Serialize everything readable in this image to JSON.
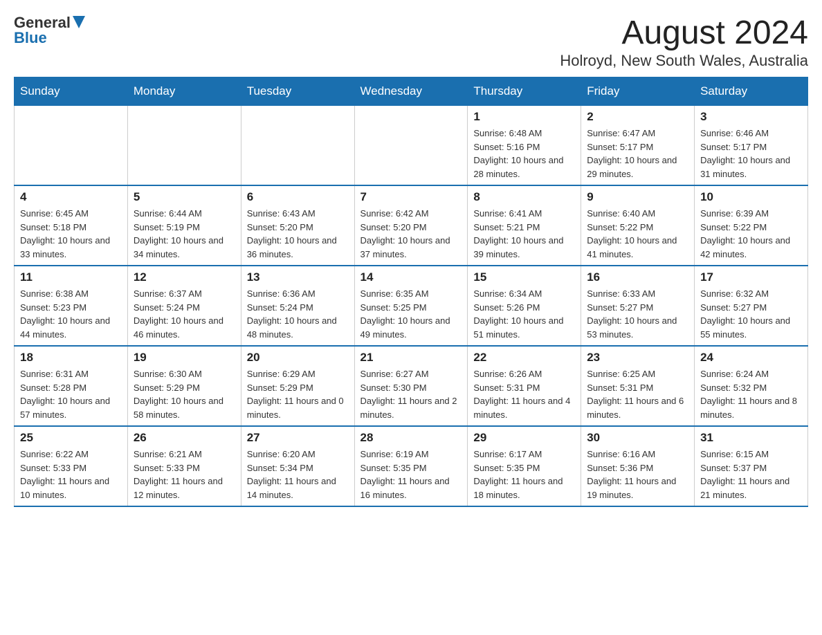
{
  "header": {
    "logo_general": "General",
    "logo_blue": "Blue",
    "month_title": "August 2024",
    "location": "Holroyd, New South Wales, Australia"
  },
  "weekdays": [
    "Sunday",
    "Monday",
    "Tuesday",
    "Wednesday",
    "Thursday",
    "Friday",
    "Saturday"
  ],
  "weeks": [
    [
      {
        "day": "",
        "info": ""
      },
      {
        "day": "",
        "info": ""
      },
      {
        "day": "",
        "info": ""
      },
      {
        "day": "",
        "info": ""
      },
      {
        "day": "1",
        "info": "Sunrise: 6:48 AM\nSunset: 5:16 PM\nDaylight: 10 hours and 28 minutes."
      },
      {
        "day": "2",
        "info": "Sunrise: 6:47 AM\nSunset: 5:17 PM\nDaylight: 10 hours and 29 minutes."
      },
      {
        "day": "3",
        "info": "Sunrise: 6:46 AM\nSunset: 5:17 PM\nDaylight: 10 hours and 31 minutes."
      }
    ],
    [
      {
        "day": "4",
        "info": "Sunrise: 6:45 AM\nSunset: 5:18 PM\nDaylight: 10 hours and 33 minutes."
      },
      {
        "day": "5",
        "info": "Sunrise: 6:44 AM\nSunset: 5:19 PM\nDaylight: 10 hours and 34 minutes."
      },
      {
        "day": "6",
        "info": "Sunrise: 6:43 AM\nSunset: 5:20 PM\nDaylight: 10 hours and 36 minutes."
      },
      {
        "day": "7",
        "info": "Sunrise: 6:42 AM\nSunset: 5:20 PM\nDaylight: 10 hours and 37 minutes."
      },
      {
        "day": "8",
        "info": "Sunrise: 6:41 AM\nSunset: 5:21 PM\nDaylight: 10 hours and 39 minutes."
      },
      {
        "day": "9",
        "info": "Sunrise: 6:40 AM\nSunset: 5:22 PM\nDaylight: 10 hours and 41 minutes."
      },
      {
        "day": "10",
        "info": "Sunrise: 6:39 AM\nSunset: 5:22 PM\nDaylight: 10 hours and 42 minutes."
      }
    ],
    [
      {
        "day": "11",
        "info": "Sunrise: 6:38 AM\nSunset: 5:23 PM\nDaylight: 10 hours and 44 minutes."
      },
      {
        "day": "12",
        "info": "Sunrise: 6:37 AM\nSunset: 5:24 PM\nDaylight: 10 hours and 46 minutes."
      },
      {
        "day": "13",
        "info": "Sunrise: 6:36 AM\nSunset: 5:24 PM\nDaylight: 10 hours and 48 minutes."
      },
      {
        "day": "14",
        "info": "Sunrise: 6:35 AM\nSunset: 5:25 PM\nDaylight: 10 hours and 49 minutes."
      },
      {
        "day": "15",
        "info": "Sunrise: 6:34 AM\nSunset: 5:26 PM\nDaylight: 10 hours and 51 minutes."
      },
      {
        "day": "16",
        "info": "Sunrise: 6:33 AM\nSunset: 5:27 PM\nDaylight: 10 hours and 53 minutes."
      },
      {
        "day": "17",
        "info": "Sunrise: 6:32 AM\nSunset: 5:27 PM\nDaylight: 10 hours and 55 minutes."
      }
    ],
    [
      {
        "day": "18",
        "info": "Sunrise: 6:31 AM\nSunset: 5:28 PM\nDaylight: 10 hours and 57 minutes."
      },
      {
        "day": "19",
        "info": "Sunrise: 6:30 AM\nSunset: 5:29 PM\nDaylight: 10 hours and 58 minutes."
      },
      {
        "day": "20",
        "info": "Sunrise: 6:29 AM\nSunset: 5:29 PM\nDaylight: 11 hours and 0 minutes."
      },
      {
        "day": "21",
        "info": "Sunrise: 6:27 AM\nSunset: 5:30 PM\nDaylight: 11 hours and 2 minutes."
      },
      {
        "day": "22",
        "info": "Sunrise: 6:26 AM\nSunset: 5:31 PM\nDaylight: 11 hours and 4 minutes."
      },
      {
        "day": "23",
        "info": "Sunrise: 6:25 AM\nSunset: 5:31 PM\nDaylight: 11 hours and 6 minutes."
      },
      {
        "day": "24",
        "info": "Sunrise: 6:24 AM\nSunset: 5:32 PM\nDaylight: 11 hours and 8 minutes."
      }
    ],
    [
      {
        "day": "25",
        "info": "Sunrise: 6:22 AM\nSunset: 5:33 PM\nDaylight: 11 hours and 10 minutes."
      },
      {
        "day": "26",
        "info": "Sunrise: 6:21 AM\nSunset: 5:33 PM\nDaylight: 11 hours and 12 minutes."
      },
      {
        "day": "27",
        "info": "Sunrise: 6:20 AM\nSunset: 5:34 PM\nDaylight: 11 hours and 14 minutes."
      },
      {
        "day": "28",
        "info": "Sunrise: 6:19 AM\nSunset: 5:35 PM\nDaylight: 11 hours and 16 minutes."
      },
      {
        "day": "29",
        "info": "Sunrise: 6:17 AM\nSunset: 5:35 PM\nDaylight: 11 hours and 18 minutes."
      },
      {
        "day": "30",
        "info": "Sunrise: 6:16 AM\nSunset: 5:36 PM\nDaylight: 11 hours and 19 minutes."
      },
      {
        "day": "31",
        "info": "Sunrise: 6:15 AM\nSunset: 5:37 PM\nDaylight: 11 hours and 21 minutes."
      }
    ]
  ]
}
